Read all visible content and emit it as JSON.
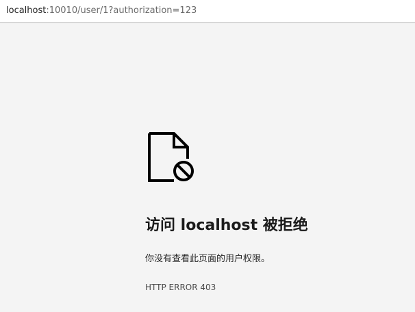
{
  "address_bar": {
    "host": "localhost",
    "rest": ":10010/user/1?authorization=123"
  },
  "icon": {
    "name": "blocked-document-icon"
  },
  "error": {
    "title": "访问 localhost 被拒绝",
    "description": "你没有查看此页面的用户权限。",
    "code": "HTTP ERROR 403"
  }
}
